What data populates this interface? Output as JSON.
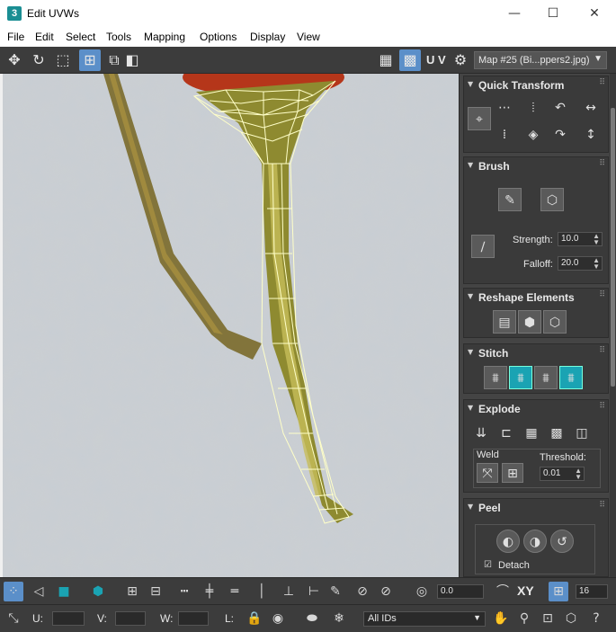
{
  "window": {
    "title": "Edit UVWs",
    "app_icon_glyph": "3",
    "controls": {
      "minimize": "—",
      "maximize": "☐",
      "close": "✕"
    }
  },
  "menu": [
    "File",
    "Edit",
    "Select",
    "Tools",
    "Mapping",
    "Options",
    "Display",
    "View"
  ],
  "toolbar": {
    "uv_label": "U V",
    "map_selector": "Map #25 (Bi...ppers2.jpg)"
  },
  "panel": {
    "quick_transform": {
      "title": "Quick Transform"
    },
    "brush": {
      "title": "Brush",
      "strength_label": "Strength:",
      "strength_value": "10.0",
      "falloff_label": "Falloff:",
      "falloff_value": "20.0"
    },
    "reshape": {
      "title": "Reshape Elements"
    },
    "stitch": {
      "title": "Stitch"
    },
    "explode": {
      "title": "Explode",
      "weld_label": "Weld",
      "threshold_label": "Threshold:",
      "threshold_value": "0.01"
    },
    "peel": {
      "title": "Peel",
      "detach_label": "Detach",
      "detach_checked": true
    }
  },
  "bottom": {
    "angle_value": "0.0",
    "xy_label": "XY",
    "count_value": "16",
    "u_label": "U:",
    "v_label": "V:",
    "w_label": "W:",
    "l_label": "L:",
    "ids_select": "All IDs"
  },
  "colors": {
    "ui_dark": "#3c3c3c",
    "active_blue": "#5b8fc9",
    "teal_accent": "#1aa3b3",
    "mesh_lines": "#ffffc8"
  }
}
